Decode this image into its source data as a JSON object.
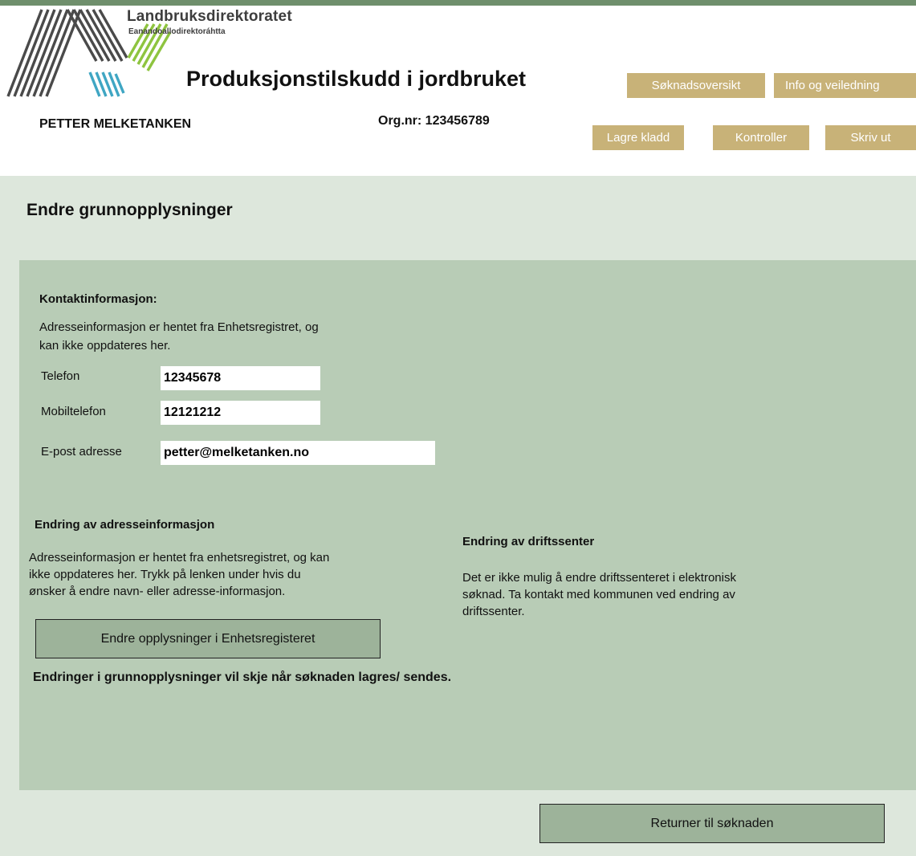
{
  "header": {
    "org_name": "Landbruksdirektoratet",
    "org_subname": "Eanandoallodirektoráhtta",
    "app_title": "Produksjonstilskudd i jordbruket",
    "user_name": "PETTER MELKETANKEN",
    "orgnr_label": "Org.nr: ",
    "orgnr_value": "123456789"
  },
  "nav": {
    "overview": "Søknadsoversikt",
    "info": "Info og veiledning",
    "save_draft": "Lagre kladd",
    "check": "Kontroller",
    "print": "Skriv ut"
  },
  "page": {
    "title": "Endre grunnopplysninger"
  },
  "contact": {
    "heading": "Kontaktinformasjon:",
    "note_line1": "Adresseinformasjon er hentet fra Enhetsregistret, og",
    "note_line2": "kan ikke oppdateres her.",
    "phone_label": "Telefon",
    "phone_value": "12345678",
    "mobile_label": "Mobiltelefon",
    "mobile_value": "12121212",
    "email_label": "E-post adresse",
    "email_value": "petter@melketanken.no"
  },
  "address_change": {
    "heading": "Endring av adresseinformasjon",
    "line1": "Adresseinformasjon er hentet fra enhetsregistret, og kan",
    "line2": "ikke oppdateres her. Trykk på lenken under hvis du",
    "line3": "ønsker å endre navn- eller adresse-informasjon.",
    "button": "Endre opplysninger i Enhetsregisteret"
  },
  "center_change": {
    "heading": "Endring av driftssenter",
    "line1": "Det er ikke mulig å endre driftssenteret i elektronisk",
    "line2": "søknad. Ta kontakt med kommunen ved endring av",
    "line3": "driftssenter."
  },
  "notice": "Endringer i grunnopplysninger vil skje når søknaden lagres/ sendes.",
  "return_button": "Returner til søknaden",
  "colors": {
    "topbar": "#6f8f6c",
    "nav_button": "#c8b278",
    "page_bg": "#dde7dc",
    "panel_bg": "#b8ccb6",
    "action_button": "#9db39a"
  }
}
